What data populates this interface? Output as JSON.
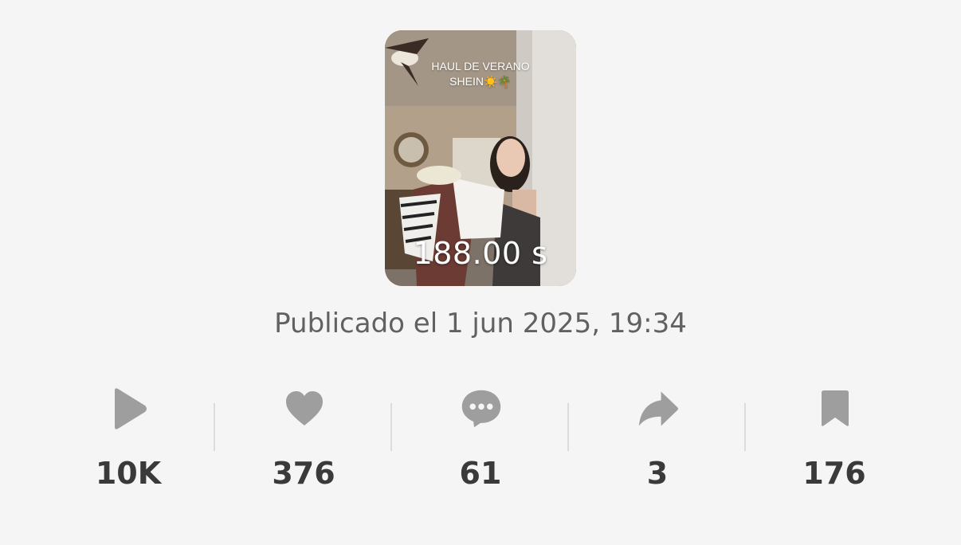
{
  "video": {
    "caption_line1": "HAUL DE VERANO",
    "caption_line2": "SHEIN☀️🌴",
    "duration": "188.00 s"
  },
  "published": "Publicado el 1 jun 2025, 19:34",
  "stats": {
    "plays": "10K",
    "likes": "376",
    "comments": "61",
    "shares": "3",
    "saves": "176"
  },
  "colors": {
    "background": "#f5f5f5",
    "icon": "#9e9e9e",
    "count_text": "#3a3a3a",
    "meta_text": "#616161"
  }
}
